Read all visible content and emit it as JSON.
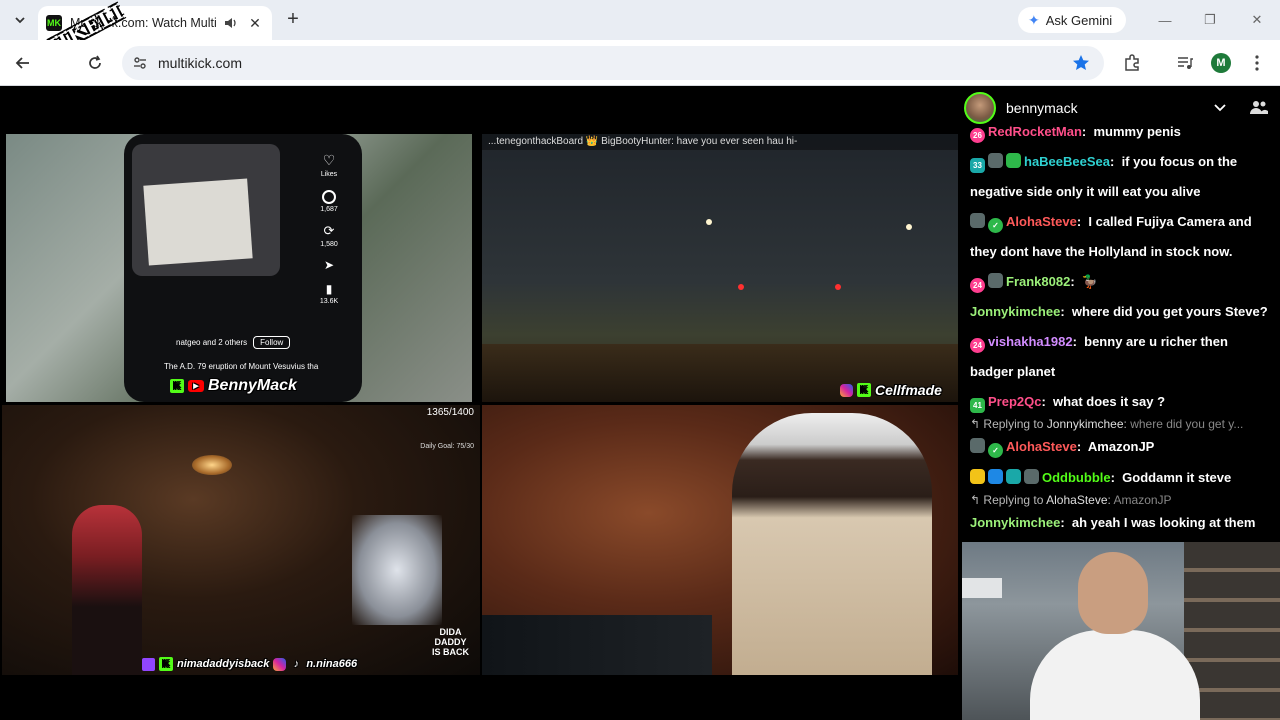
{
  "browser": {
    "tab_title": "Multikick.com: Watch Multi",
    "url": "multikick.com",
    "gemini_label": "Ask Gemini",
    "profile_initial": "M",
    "watermark": "MIKELI"
  },
  "streams": {
    "s1": {
      "caption": "The A.D. 79 eruption of Mount Vesuvius tha",
      "liked_by": "natgeo and 2 others",
      "follow_label": "Follow",
      "likes_label": "Likes",
      "comments": "1,687",
      "shares": "1,580",
      "saves": "13.6K",
      "handle": "BennyMack"
    },
    "s2": {
      "ticker": "...tenegonthackBoard  👑 BigBootyHunter: have you ever seen hau  hi-",
      "handle": "Cellfmade"
    },
    "s3": {
      "counter": "1365/1400",
      "goal": "Daily Goal: 75/30",
      "stamp_line1": "DIDA",
      "stamp_line2": "DADDY",
      "stamp_line3": "IS BACK",
      "handle_kick": "nimadaddyisback",
      "handle_tt": "n.nina666"
    }
  },
  "chat": {
    "streamer": "bennymack",
    "messages": [
      {
        "badges": [
          "26"
        ],
        "user": "RedRocketMan",
        "text": "mummy penis"
      },
      {
        "badges": [
          "33",
          "",
          ""
        ],
        "user": "haBeeBeeSea",
        "text": "if you focus on the negative side only it will eat you alive"
      },
      {
        "badges": [
          "",
          ""
        ],
        "user": "AlohaSteve",
        "text": "I called Fujiya Camera and they dont have the Hollyland in stock now."
      },
      {
        "badges": [
          "24",
          ""
        ],
        "user": "Frank8082",
        "text": "🦆"
      },
      {
        "user": "Jonnykimchee",
        "text": "where did you get yours Steve?"
      },
      {
        "badges": [
          "24"
        ],
        "user": "vishakha1982",
        "text": "benny are u richer then badger planet"
      },
      {
        "badges": [
          "41"
        ],
        "user": "Prep2Qc",
        "text": "what does it say ?"
      },
      {
        "badges": [
          "",
          ""
        ],
        "user": "AlohaSteve",
        "text": "AmazonJP"
      },
      {
        "badges": [
          "",
          "",
          "",
          ""
        ],
        "user": "Oddbubble",
        "text": "Goddamn it steve"
      },
      {
        "user": "Jonnykimchee",
        "text": "ah yeah I was looking at them"
      }
    ],
    "replies": [
      {
        "prefix": "Replying to",
        "to": "Jonnykimchee",
        "snippet": "where did you get y..."
      },
      {
        "prefix": "Replying to",
        "to": "AlohaSteve",
        "snippet": "AmazonJP"
      }
    ]
  },
  "colors": {
    "kick_green": "#53fc18",
    "badge_pink": "#ff3e8f"
  }
}
